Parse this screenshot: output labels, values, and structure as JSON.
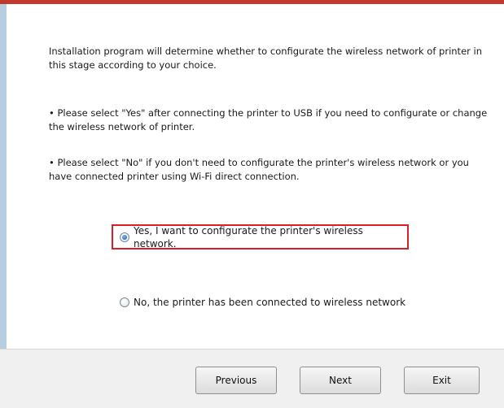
{
  "dialog": {
    "intro": "Installation program will determine whether to configurate the wireless network of printer in this stage according to your choice.",
    "bullet_yes": "• Please select \"Yes\" after connecting the printer to USB if you need to configurate or change the wireless network of printer.",
    "bullet_no": "• Please select \"No\" if you don't need to configurate the printer's wireless network or you have connected printer using Wi-Fi direct connection."
  },
  "options": {
    "yes": {
      "label": "Yes, I want to configurate the printer's wireless network.",
      "selected": true
    },
    "no": {
      "label": "No, the printer has been connected to wireless network",
      "selected": false
    }
  },
  "buttons": {
    "previous": "Previous",
    "next": "Next",
    "exit": "Exit"
  },
  "colors": {
    "highlight_border": "#d8202a",
    "top_bar": "#c0392b"
  }
}
